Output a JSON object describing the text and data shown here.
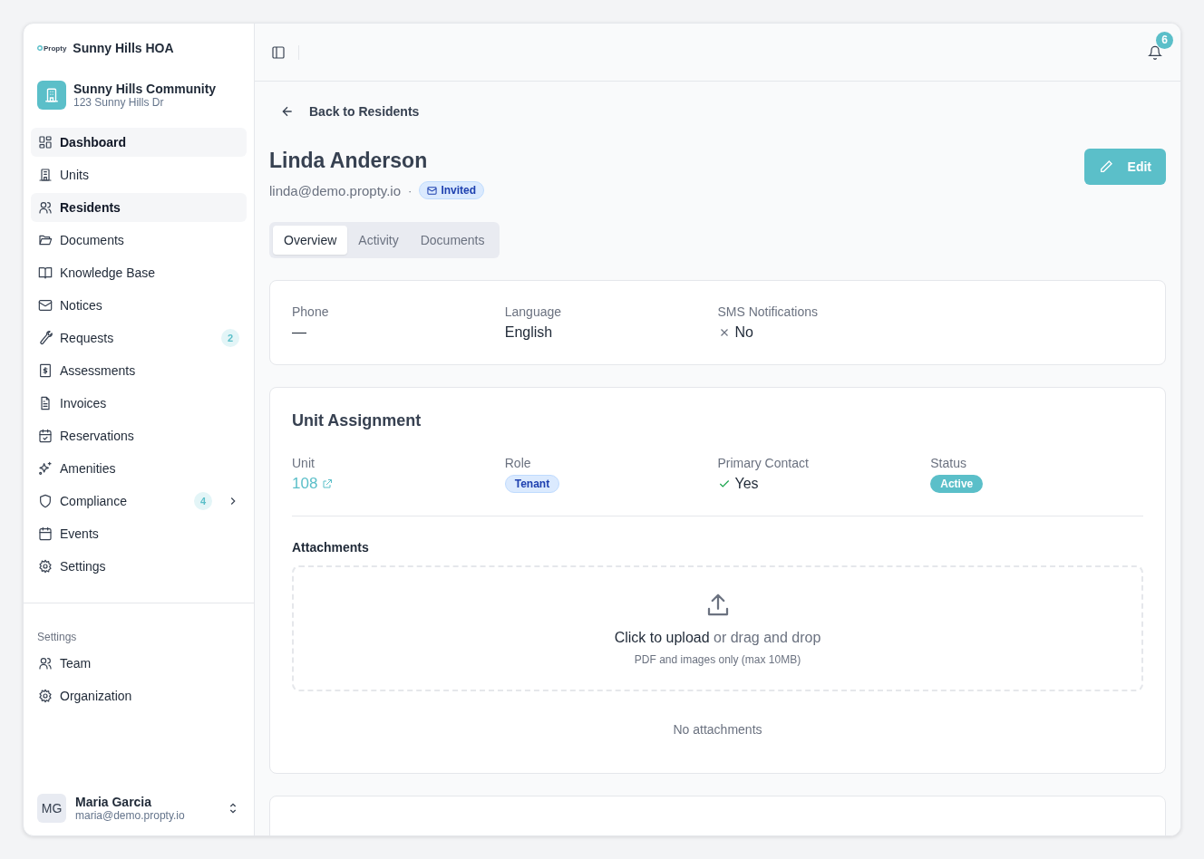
{
  "sidebar": {
    "logo_text": "Propty",
    "org_name": "Sunny Hills HOA",
    "community": {
      "name": "Sunny Hills Community",
      "address": "123 Sunny Hills Dr"
    },
    "nav": [
      {
        "label": "Dashboard",
        "selected": true
      },
      {
        "label": "Units",
        "selected": false
      },
      {
        "label": "Residents",
        "selected": true
      },
      {
        "label": "Documents",
        "selected": false
      },
      {
        "label": "Knowledge Base",
        "selected": false
      },
      {
        "label": "Notices",
        "selected": false
      },
      {
        "label": "Requests",
        "selected": false,
        "badge": "2"
      },
      {
        "label": "Assessments",
        "selected": false
      },
      {
        "label": "Invoices",
        "selected": false
      },
      {
        "label": "Reservations",
        "selected": false
      },
      {
        "label": "Amenities",
        "selected": false
      },
      {
        "label": "Compliance",
        "selected": false,
        "badge": "4",
        "expanded": false
      },
      {
        "label": "Events",
        "selected": false
      },
      {
        "label": "Settings",
        "selected": false
      }
    ],
    "settings_heading": "Settings",
    "settings_nav": [
      {
        "label": "Team",
        "selected": false
      },
      {
        "label": "Organization",
        "selected": false
      }
    ],
    "user": {
      "initials": "MG",
      "name": "Maria Garcia",
      "email": "maria@demo.propty.io"
    }
  },
  "topbar": {
    "notifications": "6"
  },
  "back_link": "Back to Residents",
  "resident": {
    "name": "Linda Anderson",
    "email": "linda@demo.propty.io",
    "separator": "·",
    "status_badge": "Invited"
  },
  "edit_button": "Edit",
  "tabs": [
    {
      "label": "Overview",
      "selected": true
    },
    {
      "label": "Activity",
      "selected": false
    },
    {
      "label": "Documents",
      "selected": false
    }
  ],
  "details": [
    {
      "label": "Phone",
      "value": "—",
      "kind": "text"
    },
    {
      "label": "Language",
      "value": "English",
      "kind": "text"
    },
    {
      "label": "SMS Notifications",
      "value": "No",
      "kind": "no"
    }
  ],
  "unit_assignment": {
    "title": "Unit Assignment",
    "fields": [
      {
        "label": "Unit",
        "value": "108",
        "kind": "link"
      },
      {
        "label": "Role",
        "value": "Tenant",
        "kind": "tag"
      },
      {
        "label": "Primary Contact",
        "value": "Yes",
        "kind": "yes"
      },
      {
        "label": "Status",
        "value": "Active",
        "kind": "status"
      }
    ],
    "attachments": {
      "title": "Attachments",
      "upload_action": "Click to upload",
      "upload_rest": "or drag and drop",
      "hint": "PDF and images only (max 10MB)",
      "empty": "No attachments"
    }
  }
}
